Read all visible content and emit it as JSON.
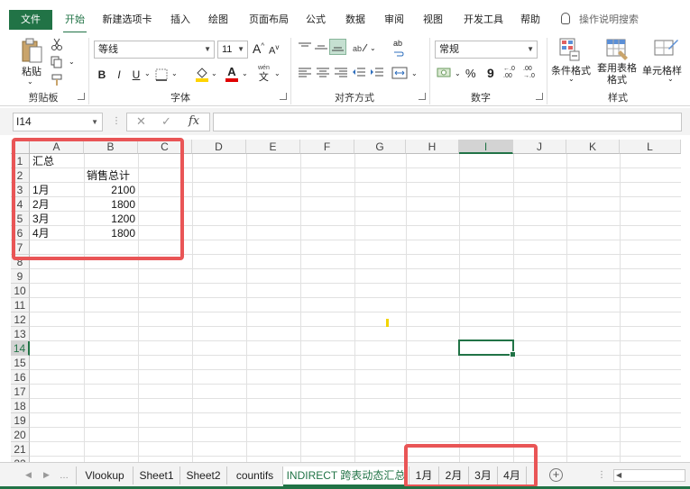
{
  "ribbon_tabs": [
    "文件",
    "开始",
    "新建选项卡",
    "插入",
    "绘图",
    "页面布局",
    "公式",
    "数据",
    "审阅",
    "视图",
    "开发工具",
    "帮助"
  ],
  "help_search": "操作说明搜索",
  "clipboard": {
    "paste": "粘贴",
    "group": "剪贴板"
  },
  "font": {
    "name": "等线",
    "size": "11",
    "group": "字体",
    "bold": "B",
    "italic": "I",
    "underline": "U",
    "grow": "A",
    "shrink": "A",
    "font_color": "A",
    "wen": "wén",
    "wen_char": "文"
  },
  "alignment": {
    "group": "对齐方式",
    "wrap": "ab"
  },
  "number": {
    "format": "常规",
    "percent": "%",
    "comma": "9",
    "group": "数字",
    "inc_decimal": "←.0 .00",
    "dec_decimal": ".00 →.0"
  },
  "styles": {
    "conditional": "条件格式",
    "table_format": "套用表格格式",
    "cell_styles": "单元格样",
    "group": "样式"
  },
  "name_box": "I14",
  "formula_bar": {
    "cancel": "✕",
    "enter": "✓",
    "fx": "fx",
    "value": ""
  },
  "columns": [
    "A",
    "B",
    "C",
    "D",
    "E",
    "F",
    "G",
    "H",
    "I",
    "J",
    "K",
    "L"
  ],
  "rows": [
    "1",
    "2",
    "3",
    "4",
    "5",
    "6",
    "7",
    "8",
    "9",
    "10",
    "11",
    "12",
    "13",
    "14",
    "15",
    "16",
    "17",
    "18",
    "19",
    "20",
    "21",
    "22"
  ],
  "selected_column": "I",
  "selected_row": "14",
  "cells": {
    "A1": "汇总",
    "B2": "销售总计",
    "A3": "1月",
    "B3": "2100",
    "A4": "2月",
    "B4": "1800",
    "A5": "3月",
    "B5": "1200",
    "A6": "4月",
    "B6": "1800"
  },
  "sheet_tabs": [
    "Vlookup",
    "Sheet1",
    "Sheet2",
    "countifs",
    "INDIRECT 跨表动态汇总",
    "1月",
    "2月",
    "3月",
    "4月"
  ],
  "active_sheet": "INDIRECT 跨表动态汇总",
  "add_sheet": "+",
  "colors": {
    "excel_green": "#217346",
    "highlight_red": "#e95556",
    "yellow_mark": "#f2d400"
  }
}
